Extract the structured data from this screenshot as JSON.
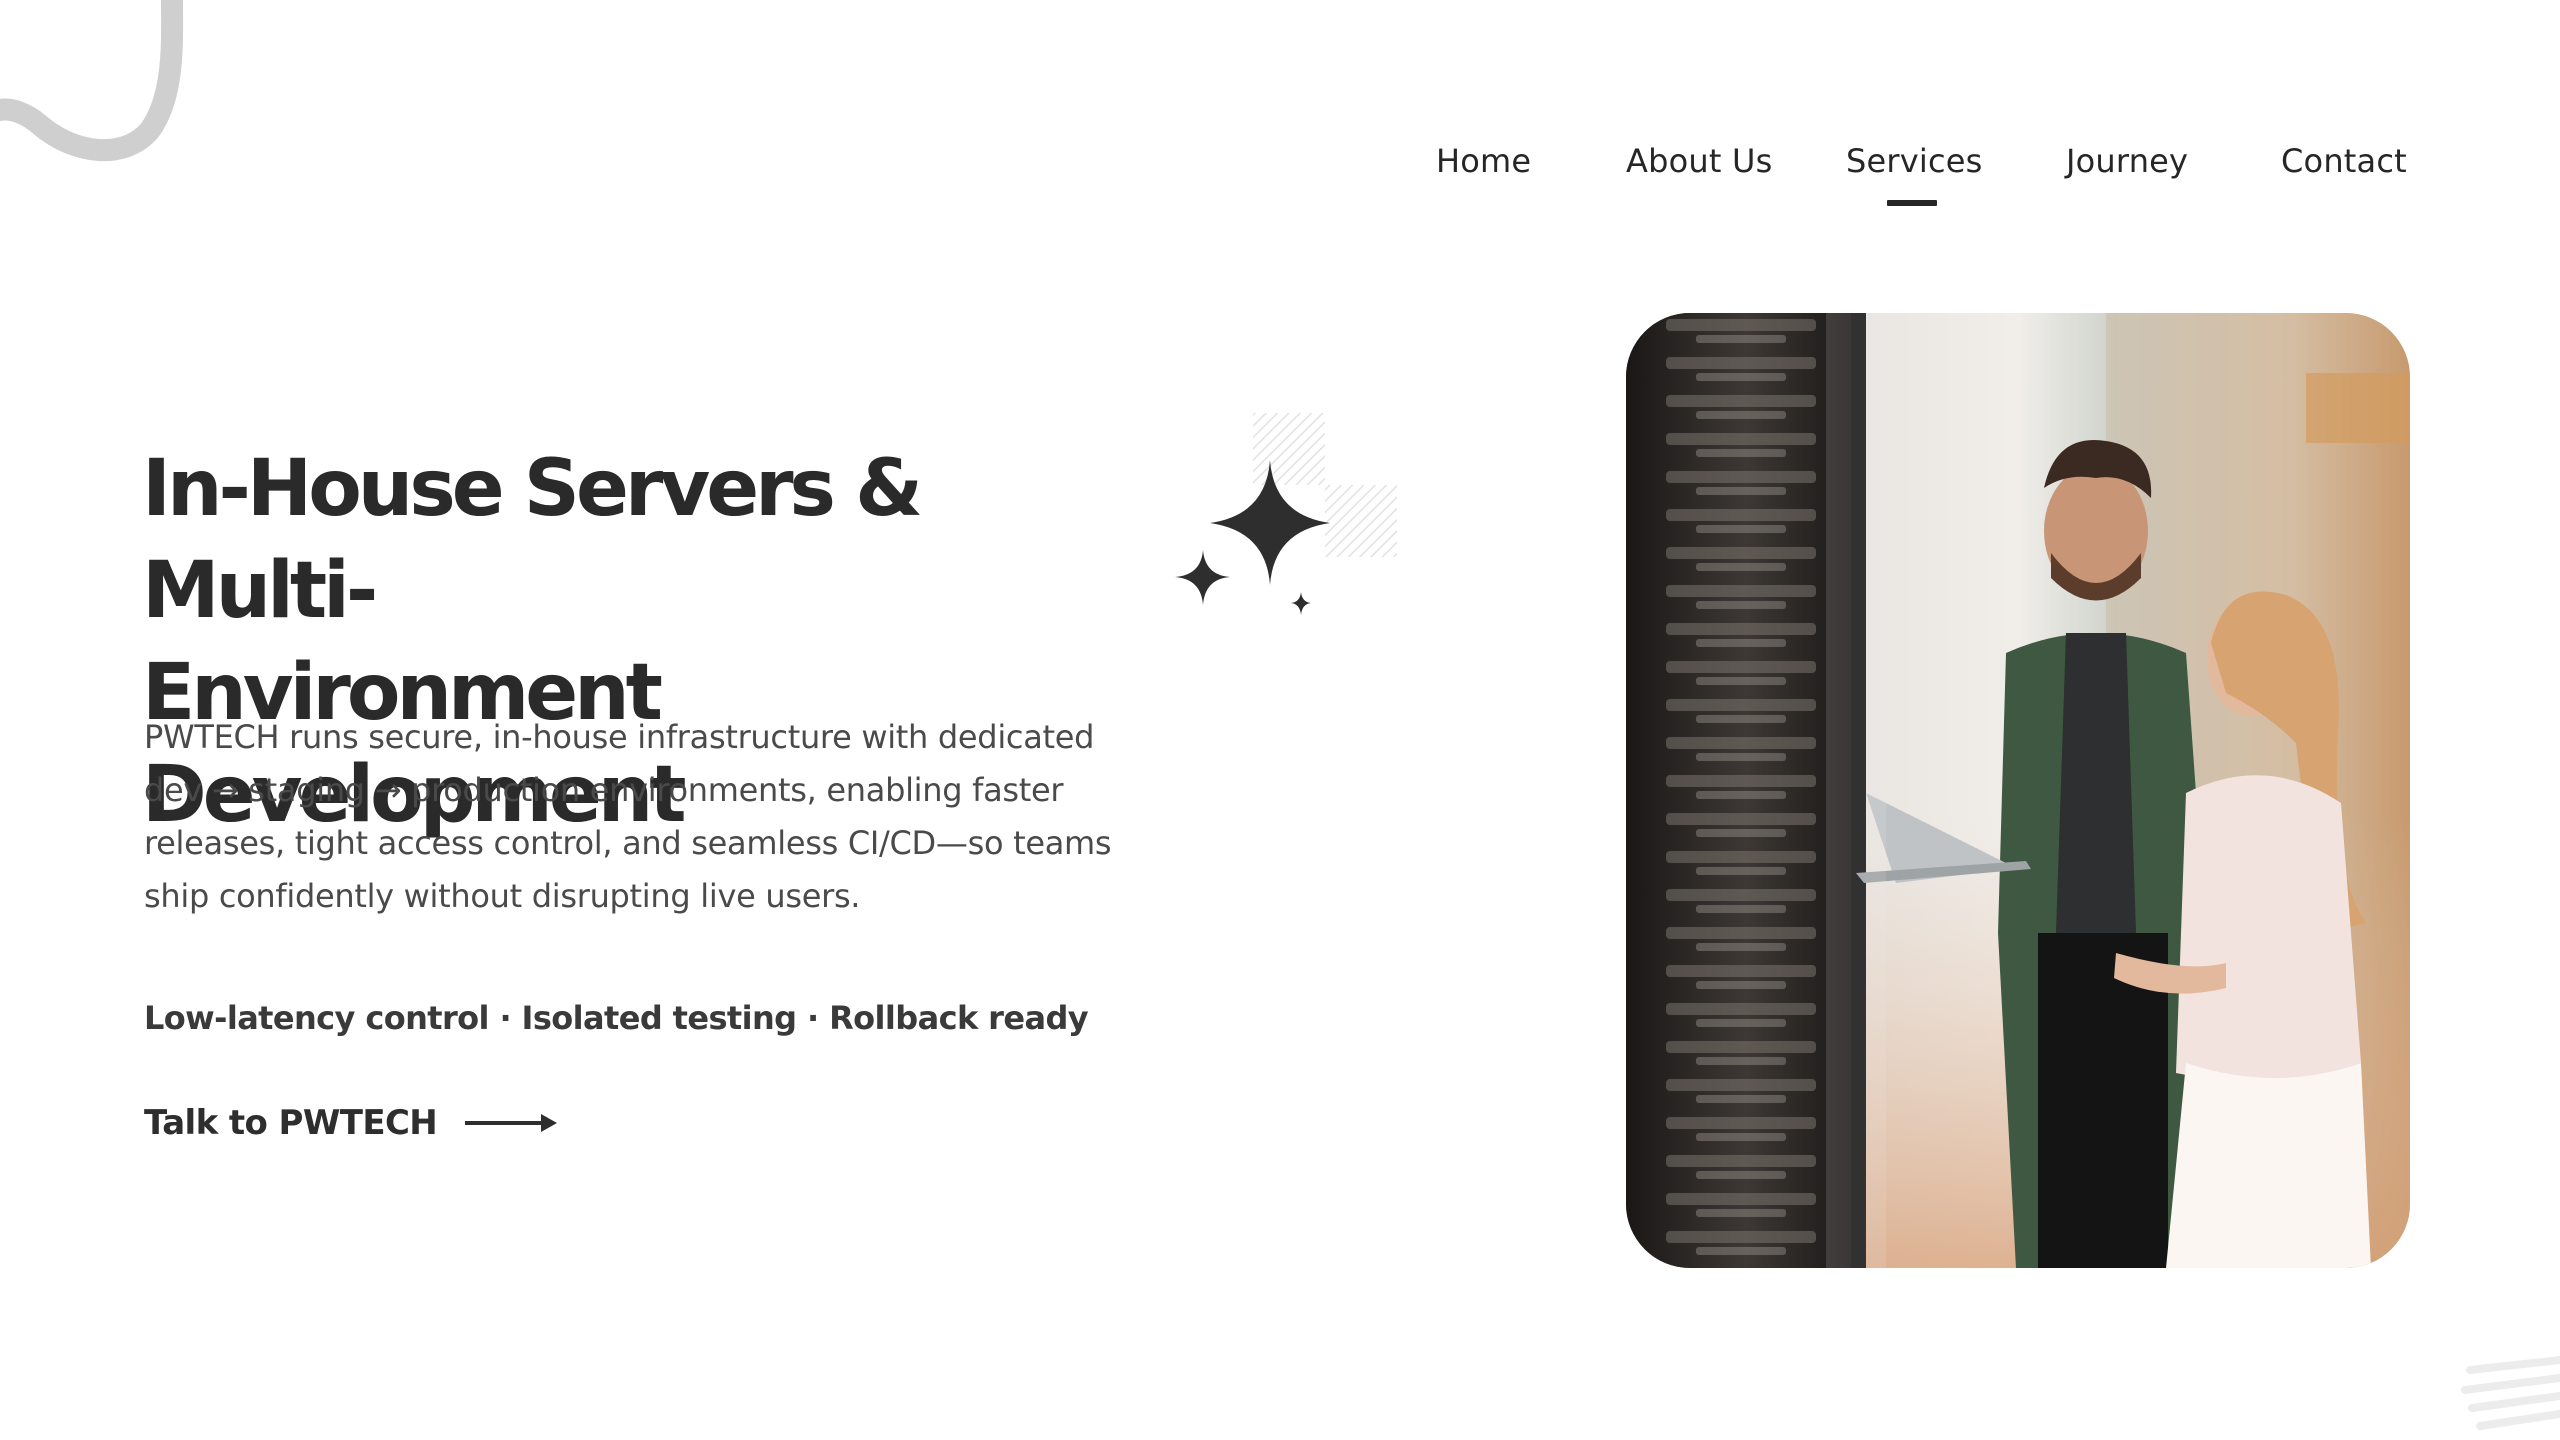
{
  "nav": {
    "items": [
      {
        "label": "Home"
      },
      {
        "label": "About Us"
      },
      {
        "label": "Services"
      },
      {
        "label": "Journey"
      },
      {
        "label": "Contact"
      }
    ],
    "active": "Services"
  },
  "hero": {
    "title_line1": "In-House Servers & Multi-",
    "title_line2": "Environment Development",
    "description": "PWTECH runs secure, in-house infrastructure with dedicated dev → staging → production environments, enabling faster releases, tight access control, and seamless CI/CD—so teams ship confidently without disrupting live users.",
    "features": "Low-latency control · Isolated testing · Rollback ready",
    "cta_label": "Talk to PWTECH"
  },
  "icons": {
    "sparkles": "sparkles-icon",
    "arrow": "arrow-right-icon"
  },
  "colors": {
    "text": "#2a2a2a",
    "body_text": "#4a4a4a",
    "decor_gray": "#cfcfcf"
  }
}
